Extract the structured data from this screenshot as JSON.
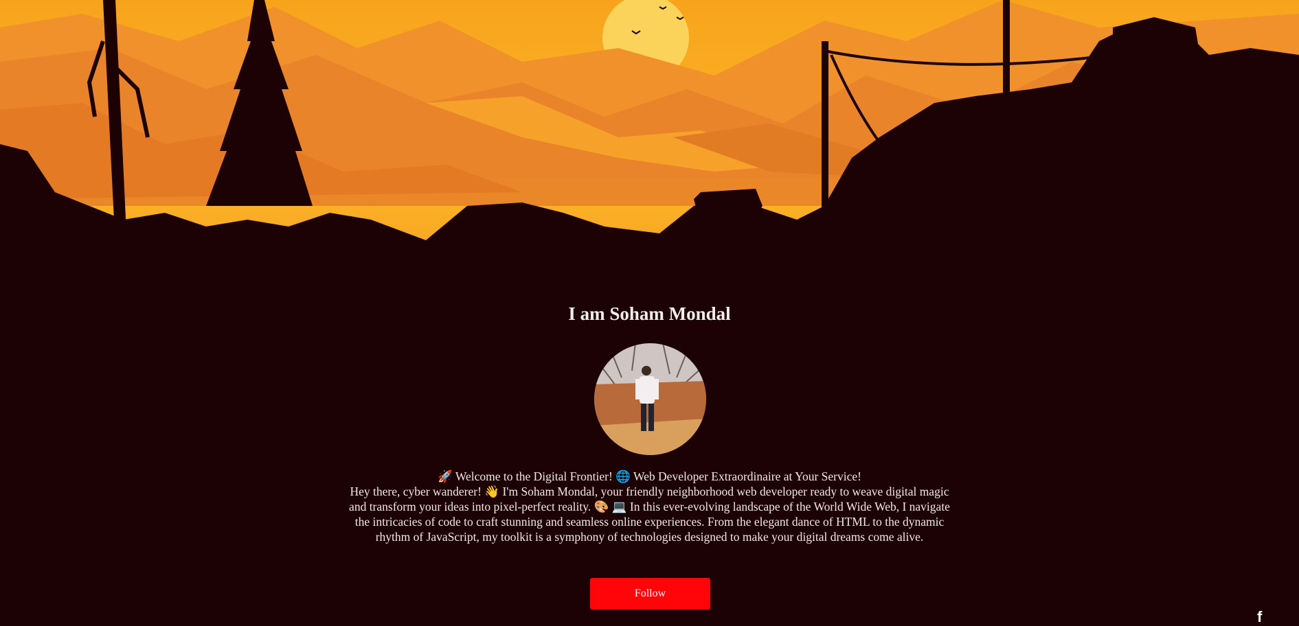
{
  "profile": {
    "heading": "I am Soham Mondal",
    "avatar_alt": "profile-photo",
    "bio_line1": "🚀 Welcome to the Digital Frontier! 🌐 Web Developer Extraordinaire at Your Service!",
    "bio_paragraph": "Hey there, cyber wanderer! 👋 I'm Soham Mondal, your friendly neighborhood web developer ready to weave digital magic and transform your ideas into pixel-perfect reality. 🎨 💻 In this ever-evolving landscape of the World Wide Web, I navigate the intricacies of code to craft stunning and seamless online experiences. From the elegant dance of HTML to the dynamic rhythm of JavaScript, my toolkit is a symphony of technologies designed to make your digital dreams come alive.",
    "follow_label": "Follow"
  },
  "social": {
    "facebook_icon_glyph": "f"
  },
  "colors": {
    "background": "#1c0204",
    "sky_top": "#f7a41c",
    "sky_bottom": "#f39a1c",
    "sun": "#fcd34d",
    "mountain_far": "#ee8f2a",
    "mountain_mid": "#e07a22",
    "follow_button": "#ff0509"
  },
  "icons": {
    "hero": "sunset-landscape-banner",
    "social": "facebook-icon"
  }
}
